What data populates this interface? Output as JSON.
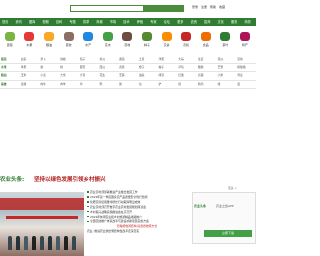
{
  "header": {
    "search_placeholder": "",
    "links": [
      "登录",
      "注册",
      "帮助",
      "收藏"
    ]
  },
  "nav": {
    "items": [
      "首页",
      "资讯",
      "图库",
      "视频",
      "百科",
      "专题",
      "供求",
      "商城",
      "市场",
      "技术",
      "养殖",
      "专家",
      "论坛",
      "更多",
      "农资",
      "招商",
      "文化",
      "服务",
      "商务"
    ]
  },
  "categories": [
    {
      "label": "蔬菜",
      "color": "#7cb342"
    },
    {
      "label": "水果",
      "color": "#e53935"
    },
    {
      "label": "粮油",
      "color": "#f9a825"
    },
    {
      "label": "畜牧",
      "color": "#8d6e63"
    },
    {
      "label": "水产",
      "color": "#1e88e5"
    },
    {
      "label": "花木",
      "color": "#43a047"
    },
    {
      "label": "药材",
      "color": "#6d4c41"
    },
    {
      "label": "种子",
      "color": "#558b2f"
    },
    {
      "label": "农资",
      "color": "#fb8c00"
    },
    {
      "label": "农机",
      "color": "#c62828"
    },
    {
      "label": "食品",
      "color": "#ef6c00"
    },
    {
      "label": "茶叶",
      "color": "#2e7d32"
    },
    {
      "label": "特产",
      "color": "#ad1457"
    }
  ],
  "grid": {
    "rows": [
      [
        "蔬菜",
        "白菜",
        "萝卜",
        "辣椒",
        "茄子",
        "黄瓜",
        "番茄",
        "土豆",
        "洋葱",
        "大蒜",
        "生姜",
        "南瓜",
        "豆角"
      ],
      [
        "水果",
        "苹果",
        "梨",
        "桃",
        "葡萄",
        "西瓜",
        "香蕉",
        "橙子",
        "柚子",
        "草莓",
        "樱桃",
        "芒果",
        "猕猴桃"
      ],
      [
        "粮油",
        "玉米",
        "小麦",
        "大米",
        "大豆",
        "花生",
        "芝麻",
        "油菜",
        "绿豆",
        "红薯",
        "高粱",
        "小米",
        "荞麦"
      ],
      [
        "畜禽",
        "生猪",
        "肉牛",
        "肉羊",
        "鸡",
        "鸭",
        "鹅",
        "兔",
        "驴",
        "鸽",
        "鹌鹑",
        "蜂",
        "蚕"
      ]
    ]
  },
  "banner": {
    "tag": "农业头条:",
    "title": "坚持以绿色发展引领乡村振兴"
  },
  "news": {
    "items": [
      "农业农村部部署推进产业融合发展工作",
      "2019年第一季度国家农产品质量安全例行监测",
      "化肥农药使用量零增长行动取得明显成效",
      "农业农村部召开数字农业农村发展规划座谈会",
      "乡村振兴战略实施推进会在京召开",
      "2019年休闲农业和乡村旅游精品线路推介",
      "全国农技推广体系改革与建设补助项目实施方案"
    ],
    "highlight": "稳粮增收调结构 提质增效转方式",
    "bottom": "农业: 推进农业供给侧结构性改革走深走实"
  },
  "login": {
    "logo": "农业头条",
    "text": "农业之窗APP",
    "button": "立即下载",
    "top_links": "更多 >"
  }
}
